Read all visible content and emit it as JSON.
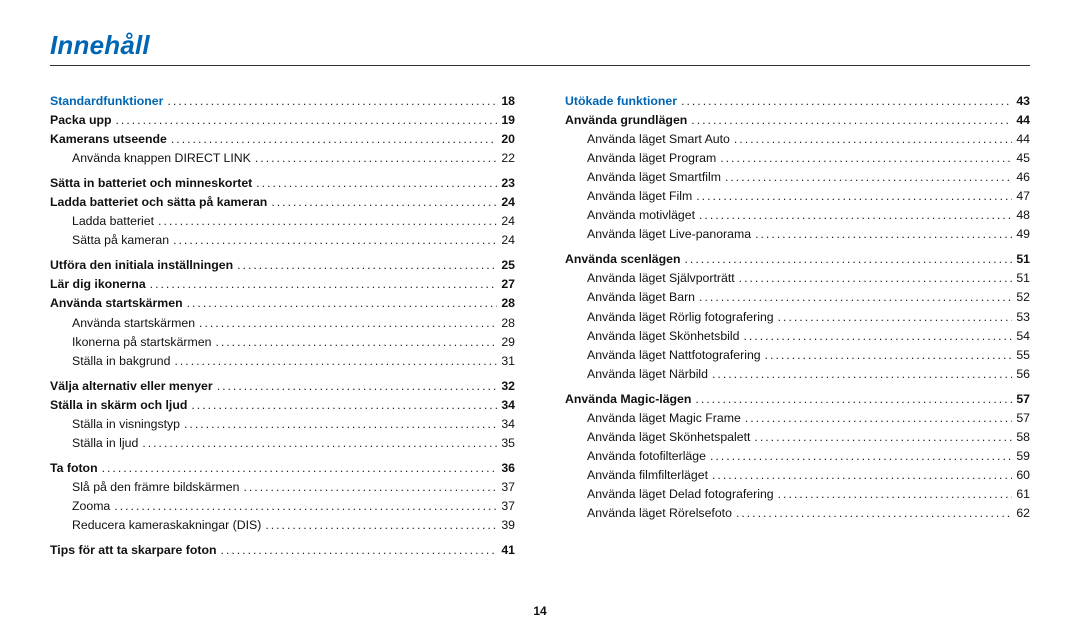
{
  "title": "Innehåll",
  "page_number": "14",
  "left": [
    {
      "depth": 0,
      "label": "Standardfunktioner",
      "page": "18"
    },
    {
      "depth": 1,
      "label": "Packa upp",
      "page": "19"
    },
    {
      "depth": 1,
      "label": "Kamerans utseende",
      "page": "20"
    },
    {
      "depth": 2,
      "label": "Använda knappen DIRECT LINK",
      "page": "22"
    },
    {
      "depth": 1,
      "label": "Sätta in batteriet och minneskortet",
      "page": "23"
    },
    {
      "depth": 1,
      "label": "Ladda batteriet och sätta på kameran",
      "page": "24"
    },
    {
      "depth": 2,
      "label": "Ladda batteriet",
      "page": "24"
    },
    {
      "depth": 2,
      "label": "Sätta på kameran",
      "page": "24"
    },
    {
      "depth": 1,
      "label": "Utföra den initiala inställningen",
      "page": "25"
    },
    {
      "depth": 1,
      "label": "Lär dig ikonerna",
      "page": "27"
    },
    {
      "depth": 1,
      "label": "Använda startskärmen",
      "page": "28"
    },
    {
      "depth": 2,
      "label": "Använda startskärmen",
      "page": "28"
    },
    {
      "depth": 2,
      "label": "Ikonerna på startskärmen",
      "page": "29"
    },
    {
      "depth": 2,
      "label": "Ställa in bakgrund",
      "page": "31"
    },
    {
      "depth": 1,
      "label": "Välja alternativ eller menyer",
      "page": "32"
    },
    {
      "depth": 1,
      "label": "Ställa in skärm och ljud",
      "page": "34"
    },
    {
      "depth": 2,
      "label": "Ställa in visningstyp",
      "page": "34"
    },
    {
      "depth": 2,
      "label": "Ställa in ljud",
      "page": "35"
    },
    {
      "depth": 1,
      "label": "Ta foton",
      "page": "36"
    },
    {
      "depth": 2,
      "label": "Slå på den främre bildskärmen",
      "page": "37"
    },
    {
      "depth": 2,
      "label": "Zooma",
      "page": "37"
    },
    {
      "depth": 2,
      "label": "Reducera kameraskakningar (DIS)",
      "page": "39"
    },
    {
      "depth": 1,
      "label": "Tips för att ta skarpare foton",
      "page": "41"
    }
  ],
  "right": [
    {
      "depth": 0,
      "label": "Utökade funktioner",
      "page": "43"
    },
    {
      "depth": 1,
      "label": "Använda grundlägen",
      "page": "44"
    },
    {
      "depth": 2,
      "label": "Använda läget Smart Auto",
      "page": "44"
    },
    {
      "depth": 2,
      "label": "Använda läget Program",
      "page": "45"
    },
    {
      "depth": 2,
      "label": "Använda läget Smartfilm",
      "page": "46"
    },
    {
      "depth": 2,
      "label": "Använda läget Film",
      "page": "47"
    },
    {
      "depth": 2,
      "label": "Använda motivläget",
      "page": "48"
    },
    {
      "depth": 2,
      "label": "Använda läget Live-panorama",
      "page": "49"
    },
    {
      "depth": 1,
      "label": "Använda scenlägen",
      "page": "51"
    },
    {
      "depth": 2,
      "label": "Använda läget Självporträtt",
      "page": "51"
    },
    {
      "depth": 2,
      "label": "Använda läget Barn",
      "page": "52"
    },
    {
      "depth": 2,
      "label": "Använda läget Rörlig fotografering",
      "page": "53"
    },
    {
      "depth": 2,
      "label": "Använda läget Skönhetsbild",
      "page": "54"
    },
    {
      "depth": 2,
      "label": "Använda läget Nattfotografering",
      "page": "55"
    },
    {
      "depth": 2,
      "label": "Använda läget Närbild",
      "page": "56"
    },
    {
      "depth": 1,
      "label": "Använda Magic-lägen",
      "page": "57"
    },
    {
      "depth": 2,
      "label": "Använda läget Magic Frame",
      "page": "57"
    },
    {
      "depth": 2,
      "label": "Använda läget Skönhetspalett",
      "page": "58"
    },
    {
      "depth": 2,
      "label": "Använda fotofilterläge",
      "page": "59"
    },
    {
      "depth": 2,
      "label": "Använda filmfilterläget",
      "page": "60"
    },
    {
      "depth": 2,
      "label": "Använda läget Delad fotografering",
      "page": "61"
    },
    {
      "depth": 2,
      "label": "Använda läget Rörelsefoto",
      "page": "62"
    }
  ]
}
